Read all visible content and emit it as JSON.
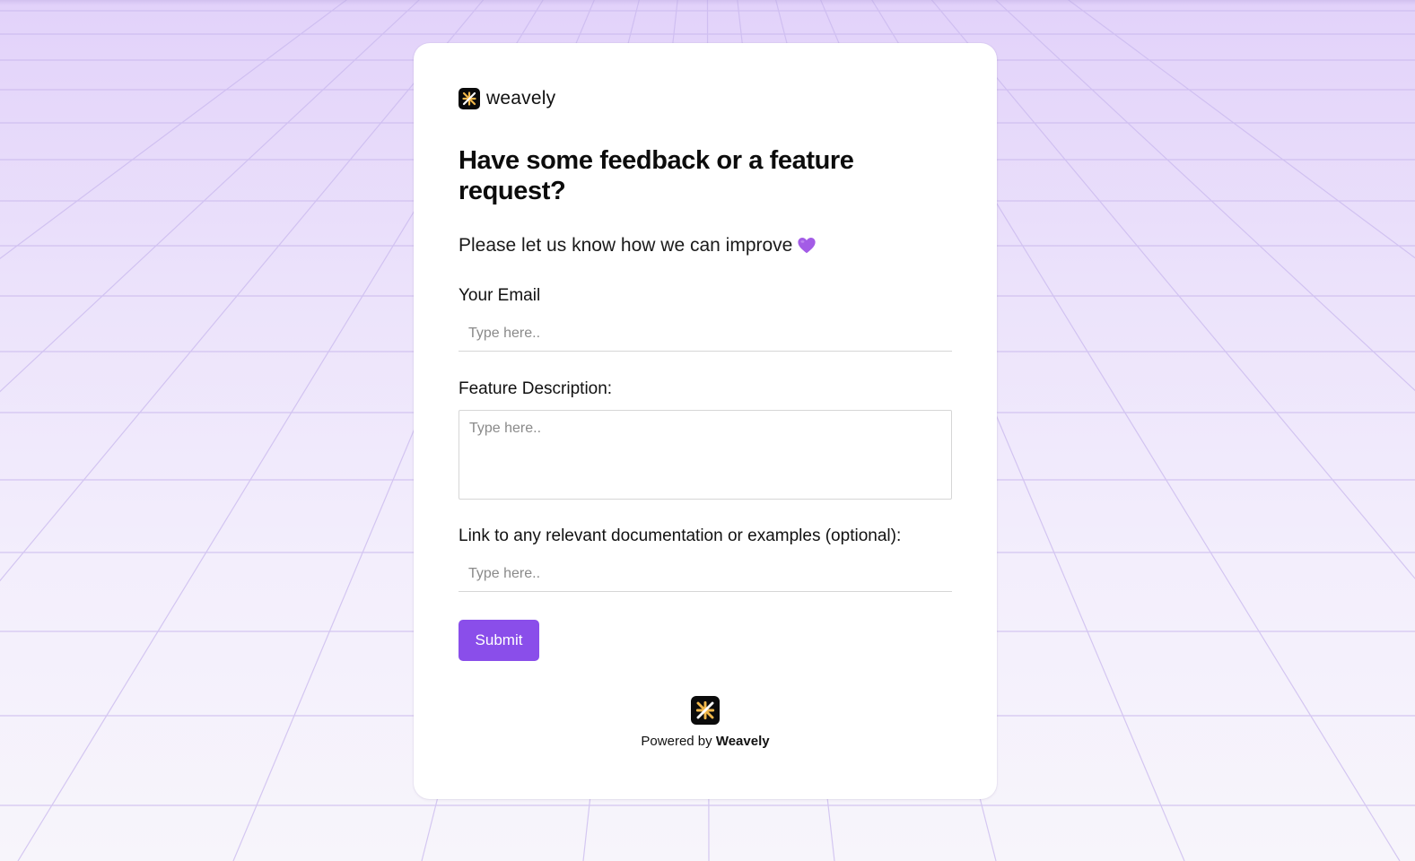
{
  "brand": {
    "name": "weavely",
    "logo_icon": "weavely-logo-icon"
  },
  "form": {
    "title": "Have some feedback or a feature request?",
    "subtitle": "Please let us know how we can improve",
    "subtitle_emoji": "purple-heart-icon",
    "fields": [
      {
        "label": "Your Email",
        "placeholder": "Type here..",
        "value": ""
      },
      {
        "label": "Feature Description:",
        "placeholder": "Type here..",
        "value": ""
      },
      {
        "label": "Link to any relevant documentation or examples (optional):",
        "placeholder": "Type here..",
        "value": ""
      }
    ],
    "submit_label": "Submit"
  },
  "footer": {
    "powered_prefix": "Powered by",
    "powered_brand": "Weavely"
  },
  "colors": {
    "accent": "#8a4eea",
    "heart": "#a35ce6",
    "logo_bg": "#0b0b0b",
    "logo_mark": "#f2b84b"
  }
}
